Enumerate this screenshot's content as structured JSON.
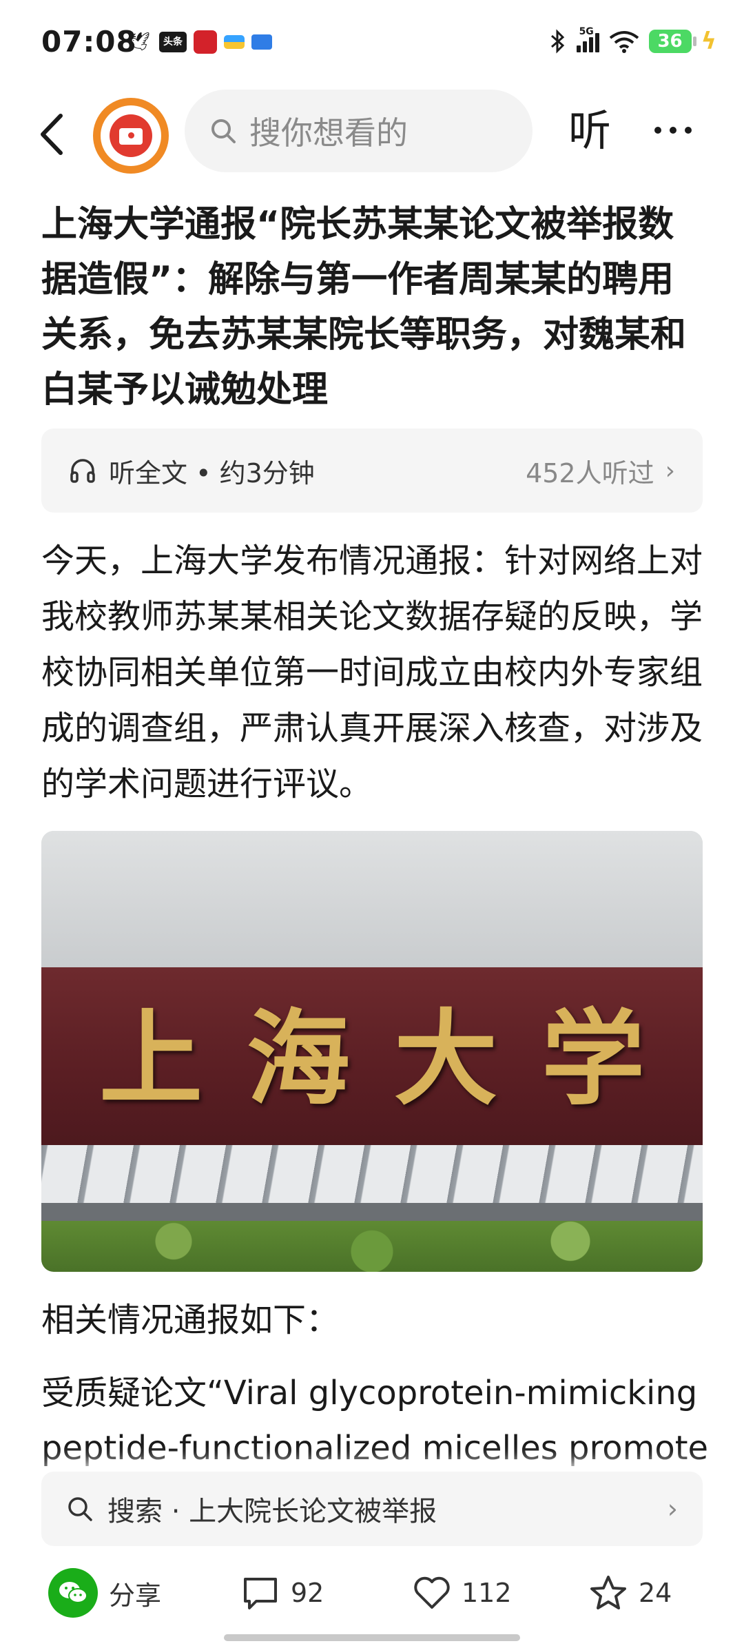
{
  "status_bar": {
    "time": "07:08",
    "app_icons": [
      "bird-icon",
      "toutiao-icon",
      "red-app-icon",
      "flag-app-icon",
      "chat-app-icon"
    ],
    "network": "5G",
    "battery": "36"
  },
  "header": {
    "search_placeholder": "搜你想看的",
    "listen_label": "听"
  },
  "article": {
    "title": "上海大学通报“院长苏某某论文被举报数据造假”：解除与第一作者周某某的聘用关系，免去苏某某院长等职务，对魏某和白某予以诫勉处理",
    "listen_bar": {
      "label": "听全文 • 约3分钟",
      "count": "452人听过"
    },
    "paragraph1": "今天，上海大学发布情况通报：针对网络上对我校教师苏某某相关论文数据存疑的反映，学校协同相关单位第一时间成立由校内外专家组成的调查组，严肃认真开展深入核查，对涉及的学术问题进行评议。",
    "photo_sign_text": "上海大学",
    "subheading": "相关情况通报如下：",
    "paragraph2_line1": "受质疑论文“Viral glycoprotein-mimicking",
    "paragraph2_line2": "peptide-functionalized micelles promote"
  },
  "search_suggestion": {
    "text": "搜索 · 上大院长论文被举报"
  },
  "bottom_bar": {
    "share_label": "分享",
    "comments": "92",
    "likes": "112",
    "favorites": "24"
  },
  "colors": {
    "accent_orange": "#f08a24",
    "wechat_green": "#1aad19",
    "battery_green": "#4cd964"
  }
}
